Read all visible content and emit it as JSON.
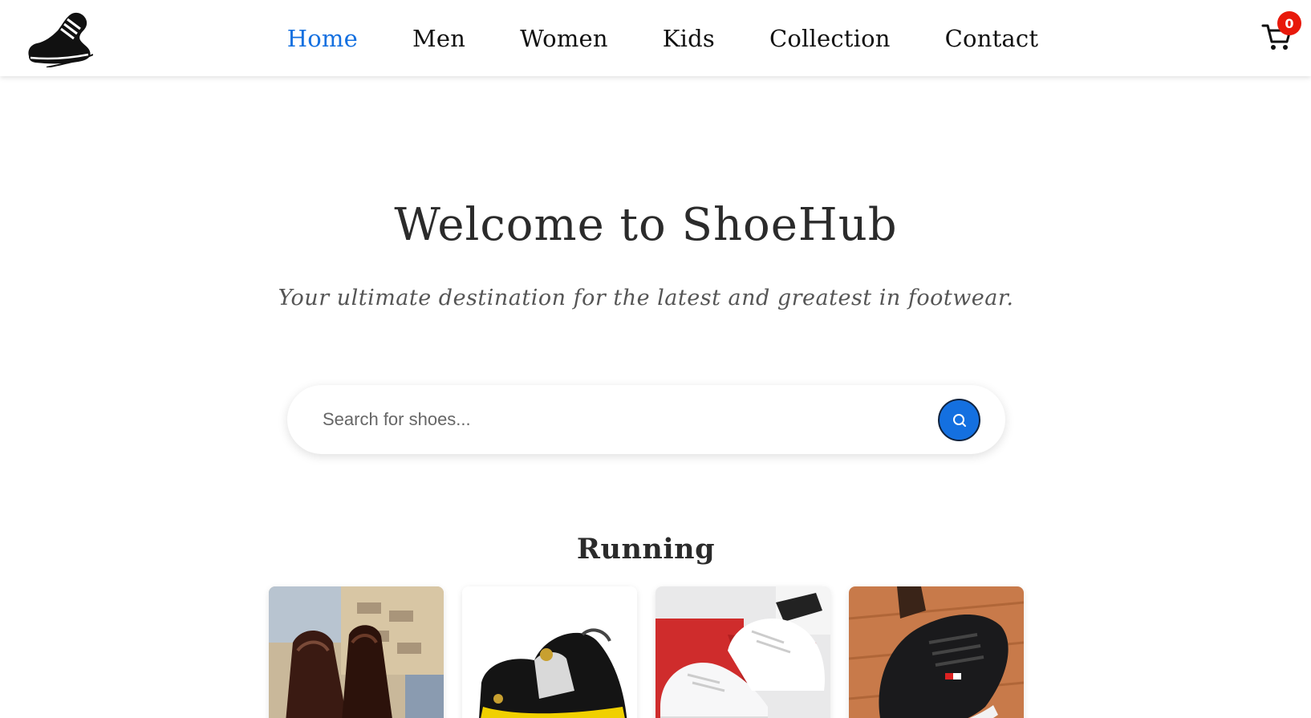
{
  "nav": {
    "links": [
      {
        "label": "Home",
        "active": true
      },
      {
        "label": "Men",
        "active": false
      },
      {
        "label": "Women",
        "active": false
      },
      {
        "label": "Kids",
        "active": false
      },
      {
        "label": "Collection",
        "active": false
      },
      {
        "label": "Contact",
        "active": false
      }
    ],
    "logo_icon": "sneaker-logo-icon",
    "cart_icon": "shopping-cart-icon",
    "cart_count": "0"
  },
  "hero": {
    "title": "Welcome to ShoeHub",
    "subtitle": "Your ultimate destination for the latest and greatest in footwear."
  },
  "search": {
    "placeholder": "Search for shoes...",
    "value": "",
    "button_icon": "search-icon"
  },
  "section": {
    "title": "Running",
    "cards": [
      {
        "image": "brown-loafers-image"
      },
      {
        "image": "black-yellow-sneaker-image"
      },
      {
        "image": "white-sneakers-image"
      },
      {
        "image": "black-casual-sneaker-image"
      }
    ]
  },
  "colors": {
    "accent": "#1470e0",
    "badge": "#e8190b"
  }
}
